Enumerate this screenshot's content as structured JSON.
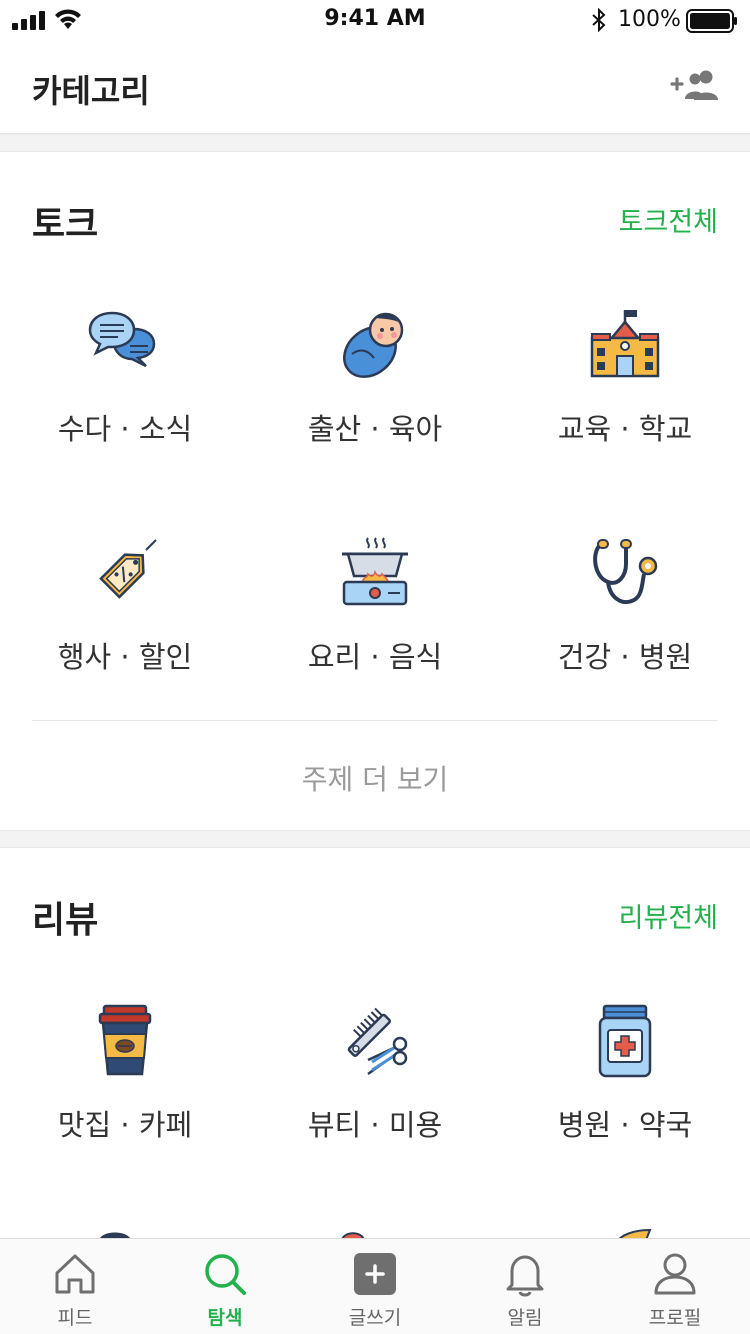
{
  "status_bar": {
    "time": "9:41 AM",
    "battery": "100%"
  },
  "header": {
    "title": "카테고리",
    "add_friend_icon": "add-friend-icon"
  },
  "talk": {
    "title": "토크",
    "see_all": "토크전체",
    "items": [
      {
        "label": "수다 · 소식",
        "icon": "chat-bubbles-icon"
      },
      {
        "label": "출산 · 육아",
        "icon": "baby-icon"
      },
      {
        "label": "교육 · 학교",
        "icon": "school-icon"
      },
      {
        "label": "행사 · 할인",
        "icon": "discount-tag-icon"
      },
      {
        "label": "요리 · 음식",
        "icon": "cooking-pot-icon"
      },
      {
        "label": "건강 · 병원",
        "icon": "stethoscope-icon"
      }
    ],
    "more": "주제 더 보기"
  },
  "review": {
    "title": "리뷰",
    "see_all": "리뷰전체",
    "items": [
      {
        "label": "맛집 · 카페",
        "icon": "coffee-cup-icon"
      },
      {
        "label": "뷰티 · 미용",
        "icon": "comb-scissors-icon"
      },
      {
        "label": "병원 · 약국",
        "icon": "medicine-bottle-icon"
      }
    ]
  },
  "tab_bar": {
    "active": "탐색",
    "tabs": [
      {
        "label": "피드",
        "icon": "home-icon"
      },
      {
        "label": "탐색",
        "icon": "search-icon"
      },
      {
        "label": "글쓰기",
        "icon": "plus-square-icon"
      },
      {
        "label": "알림",
        "icon": "bell-icon"
      },
      {
        "label": "프로필",
        "icon": "profile-icon"
      }
    ]
  },
  "colors": {
    "accent": "#22b14c",
    "text": "#222222",
    "muted": "#9a9a9a"
  }
}
